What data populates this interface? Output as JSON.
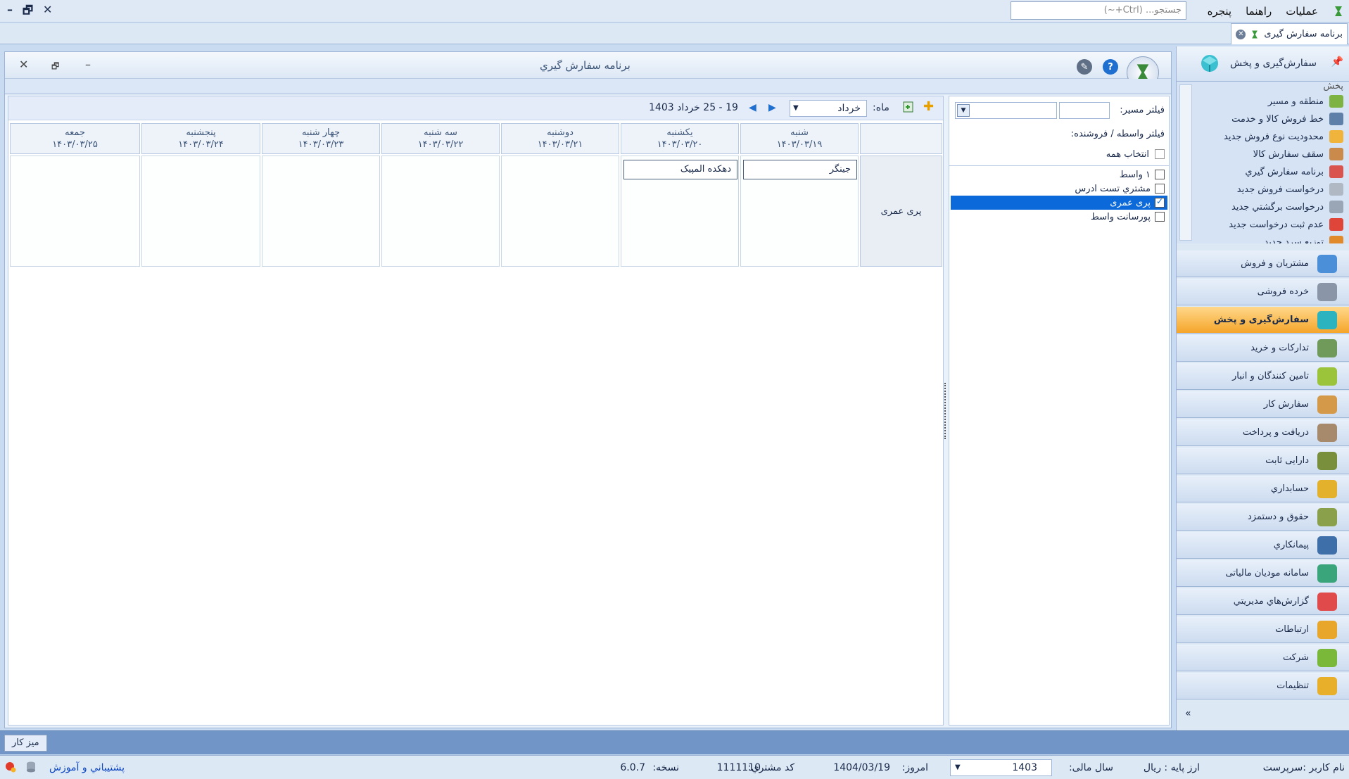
{
  "menubar": {
    "items": [
      "عملیات",
      "راهنما",
      "پنجره"
    ],
    "search_placeholder": "جستجو... (Ctrl+~)",
    "window_controls": [
      "✕",
      "🗗",
      "–"
    ]
  },
  "doc_tab": {
    "label": "برنامه سفارش گیری"
  },
  "inner_window": {
    "title": "برنامه سفارش گيري",
    "controls": [
      "✕",
      "🗗",
      "–"
    ]
  },
  "calendar": {
    "month_label": "ماه:",
    "month_value": "خرداد",
    "week_range": "19 - 25 خرداد 1403",
    "days": [
      {
        "name": "شنبه",
        "date": "۱۴۰۳/۰۳/۱۹"
      },
      {
        "name": "يکشنبه",
        "date": "۱۴۰۳/۰۳/۲۰"
      },
      {
        "name": "دوشنبه",
        "date": "۱۴۰۳/۰۳/۲۱"
      },
      {
        "name": "سه شنبه",
        "date": "۱۴۰۳/۰۳/۲۲"
      },
      {
        "name": "چهار شنبه",
        "date": "۱۴۰۳/۰۳/۲۳"
      },
      {
        "name": "پنجشنبه",
        "date": "۱۴۰۳/۰۳/۲۴"
      },
      {
        "name": "جمعه",
        "date": "۱۴۰۳/۰۳/۲۵"
      }
    ],
    "row_label": "پری عمری",
    "orders": {
      "sat": "جینگر",
      "sun": "دهکده المپیک"
    }
  },
  "filter": {
    "route_label": "فیلتر مسیر:",
    "agent_label": "فیلتر واسطه / فروشنده:",
    "select_all": "انتخاب همه",
    "items": [
      {
        "label": "۱ واسط",
        "checked": false,
        "selected": false
      },
      {
        "label": "مشتري تست ادرس",
        "checked": false,
        "selected": false
      },
      {
        "label": "پری عمری",
        "checked": true,
        "selected": true
      },
      {
        "label": "پورسانت واسط",
        "checked": false,
        "selected": false
      }
    ]
  },
  "nav": {
    "header": "سفارش‌گیری و پخش",
    "sub_partial": "پخش",
    "sub_items": [
      {
        "label": "منطقه و مسير",
        "color": "#7cb342"
      },
      {
        "label": "خط فروش کالا و خدمت",
        "color": "#5d7fa8"
      },
      {
        "label": "محدوديت نوع فروش جديد",
        "color": "#f0b43c"
      },
      {
        "label": "سقف سفارش کالا",
        "color": "#c98a4b"
      },
      {
        "label": "برنامه سفارش گيري",
        "color": "#d9534f"
      },
      {
        "label": "درخواست فروش جديد",
        "color": "#b0b8c4"
      },
      {
        "label": "درخواست برگشتي جديد",
        "color": "#9aa6b6"
      },
      {
        "label": "عدم ثبت درخواست جديد",
        "color": "#e0453a"
      },
      {
        "label": "توزيع سرد جديد",
        "color": "#e08a2c"
      }
    ],
    "items": [
      {
        "label": "مشتریان و فروش",
        "color": "#4a8fd8",
        "active": false
      },
      {
        "label": "خرده فروشی",
        "color": "#8a96a8",
        "active": false
      },
      {
        "label": "سفارش‌گیری و پخش",
        "color": "#2bb3c0",
        "active": true
      },
      {
        "label": "تدارکات و خرید",
        "color": "#6f9a5a",
        "active": false
      },
      {
        "label": "تامین کنندگان و انبار",
        "color": "#9bc43a",
        "active": false
      },
      {
        "label": "سفارش کار",
        "color": "#d49a4a",
        "active": false
      },
      {
        "label": "دریافت و پرداخت",
        "color": "#a7896b",
        "active": false
      },
      {
        "label": "دارایی ثابت",
        "color": "#7a8f3b",
        "active": false
      },
      {
        "label": "حسابداري",
        "color": "#e3b12b",
        "active": false
      },
      {
        "label": "حقوق و دستمزد",
        "color": "#8aa04a",
        "active": false
      },
      {
        "label": "پیمانکاري",
        "color": "#3f6fa8",
        "active": false
      },
      {
        "label": "سامانه مودیان مالیاتی",
        "color": "#3aa57a",
        "active": false
      },
      {
        "label": "گزارش‌هاي مديريتي",
        "color": "#e04a4a",
        "active": false
      },
      {
        "label": "ارتباطات",
        "color": "#e8a62a",
        "active": false
      },
      {
        "label": "شرکت",
        "color": "#7ab83a",
        "active": false
      },
      {
        "label": "تنظیمات",
        "color": "#e8b02a",
        "active": false
      }
    ]
  },
  "taskbar": {
    "desk_label": "ميز کار"
  },
  "status": {
    "user": "نام کاربر :سرپرست",
    "currency": "ارز پايه :  ريال",
    "fiscal_label": "سال مالی:",
    "fiscal_value": "1403",
    "today_label": "امروز:",
    "today_value": "1404/03/19",
    "customer_label": "کد مشتري:",
    "customer_value": "1111110",
    "version_label": "نسخه:",
    "version_value": "6.0.7",
    "support": "پشتيباني و آموزش"
  }
}
